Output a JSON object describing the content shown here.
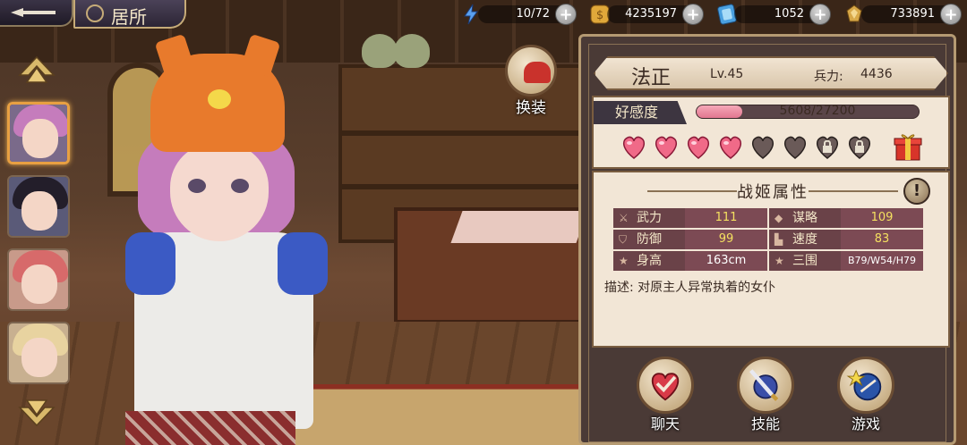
{
  "header": {
    "title": "居所"
  },
  "resources": [
    {
      "icon": "lightning-icon",
      "value": "10/72",
      "color": "#5aa0f0"
    },
    {
      "icon": "gold-coin-icon",
      "value": "4235197",
      "color": "#e0a83a"
    },
    {
      "icon": "blue-gem-card-icon",
      "value": "1052",
      "color": "#4aa0e0"
    },
    {
      "icon": "gold-token-icon",
      "value": "733891",
      "color": "#d8a848"
    }
  ],
  "roster": {
    "portraits": [
      {
        "icon": "pink-hair-girl-portrait",
        "hair_color": "#c57cbc",
        "bg": "#7a6a8a",
        "active": true
      },
      {
        "icon": "black-hair-girl-portrait",
        "hair_color": "#231e2a",
        "bg": "#5a5a78",
        "active": false
      },
      {
        "icon": "red-hair-girl-portrait",
        "hair_color": "#d76a6a",
        "bg": "#c89a8a",
        "active": false
      },
      {
        "icon": "blonde-hair-girl-portrait",
        "hair_color": "#e8d3a0",
        "bg": "#c8b090",
        "active": false
      }
    ]
  },
  "outfit_button": {
    "label": "换装"
  },
  "character": {
    "name": "法正",
    "level": "Lv.45",
    "power_label": "兵力:",
    "power_value": "4436"
  },
  "affinity": {
    "label": "好感度",
    "value": "5608/27200",
    "fraction": 0.206,
    "hearts": [
      {
        "state": "full"
      },
      {
        "state": "full"
      },
      {
        "state": "full"
      },
      {
        "state": "full"
      },
      {
        "state": "empty"
      },
      {
        "state": "empty"
      },
      {
        "state": "locked"
      },
      {
        "state": "locked"
      }
    ],
    "gift_icon": "gift-box-icon"
  },
  "attributes": {
    "title": "战姬属性",
    "info_icon": "!",
    "stats": [
      {
        "label": "武力",
        "value": "111",
        "value_color": "#f4e060",
        "icon": "sword-icon"
      },
      {
        "label": "谋略",
        "value": "109",
        "value_color": "#f4e060",
        "icon": "strategy-icon"
      },
      {
        "label": "防御",
        "value": "99",
        "value_color": "#f4e060",
        "icon": "shield-icon"
      },
      {
        "label": "速度",
        "value": "83",
        "value_color": "#f4e060",
        "icon": "boot-icon"
      },
      {
        "label": "身高",
        "value": "163cm",
        "value_color": "#ffffff",
        "icon": "star-icon"
      },
      {
        "label": "三围",
        "value": "B79/W54/H79",
        "value_color": "#ffffff",
        "icon": "star-icon"
      }
    ],
    "description_label": "描述:",
    "description": "对原主人异常执着的女仆"
  },
  "actions": [
    {
      "label": "聊天",
      "icon": "heart-chat-icon"
    },
    {
      "label": "技能",
      "icon": "sword-shield-icon"
    },
    {
      "label": "游戏",
      "icon": "stars-game-icon"
    }
  ]
}
